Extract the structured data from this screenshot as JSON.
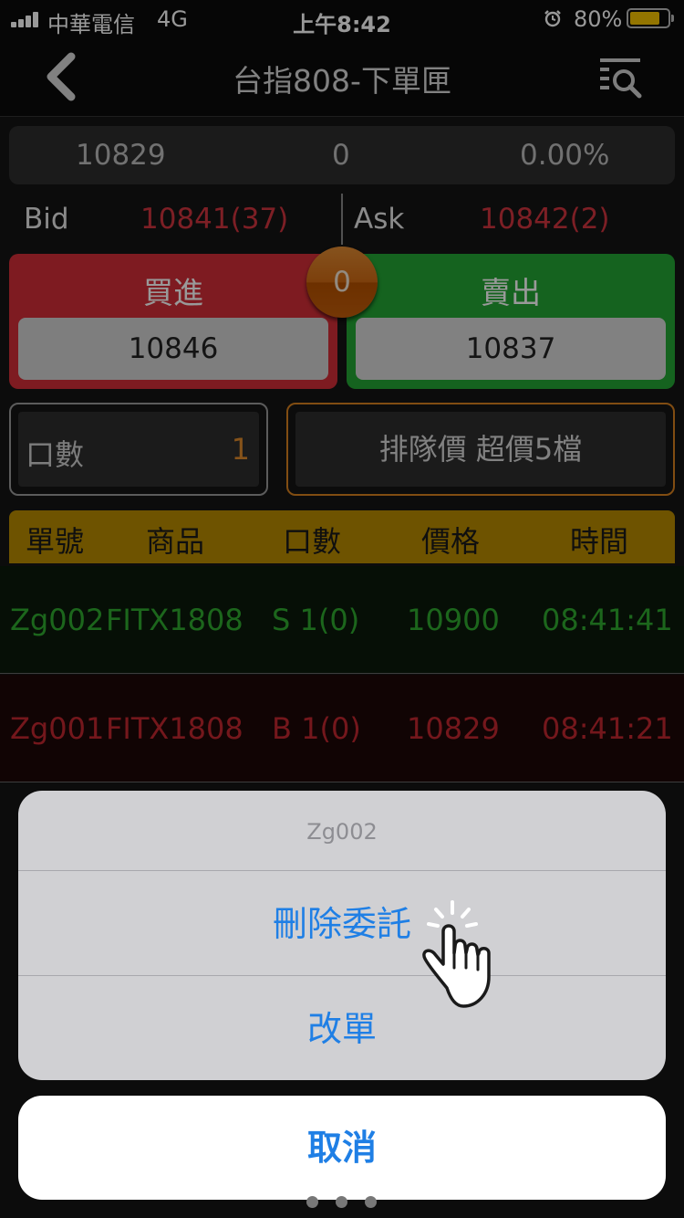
{
  "status_bar": {
    "carrier": "中華電信",
    "network": "4G",
    "time": "上午8:42",
    "battery_percent": "80%",
    "battery_level": 0.8,
    "alarm_icon": "alarm-clock-icon"
  },
  "nav": {
    "title": "台指808-下單匣",
    "back_icon": "chevron-left-icon",
    "right_icon": "list-search-icon"
  },
  "quote": {
    "last": "10829",
    "change": "0",
    "change_pct": "0.00%"
  },
  "bidask": {
    "bid_label": "Bid",
    "bid_value": "10841(37)",
    "ask_label": "Ask",
    "ask_value": "10842(2)"
  },
  "trade": {
    "buy_label": "買進",
    "buy_price": "10846",
    "sell_label": "賣出",
    "sell_price": "10837",
    "position": "0"
  },
  "order_form": {
    "qty_label": "口數",
    "qty_value": "1",
    "price_type": "排隊價 超價5檔"
  },
  "order_table": {
    "headers": [
      "單號",
      "商品",
      "口數",
      "價格",
      "時間"
    ],
    "rows": [
      {
        "id": "Zg002",
        "product": "FITX1808",
        "qty": "S 1(0)",
        "price": "10900",
        "time": "08:41:41",
        "side": "sell"
      },
      {
        "id": "Zg001",
        "product": "FITX1808",
        "qty": "B 1(0)",
        "price": "10829",
        "time": "08:41:21",
        "side": "buy"
      }
    ]
  },
  "action_sheet": {
    "title": "Zg002",
    "delete_label": "刪除委託",
    "modify_label": "改單",
    "cancel_label": "取消"
  },
  "colors": {
    "buy_red": "#d22e37",
    "sell_green": "#23a534",
    "header_gold": "#b88a00",
    "accent_orange": "#d8801e",
    "ios_blue": "#1f7fe5"
  }
}
